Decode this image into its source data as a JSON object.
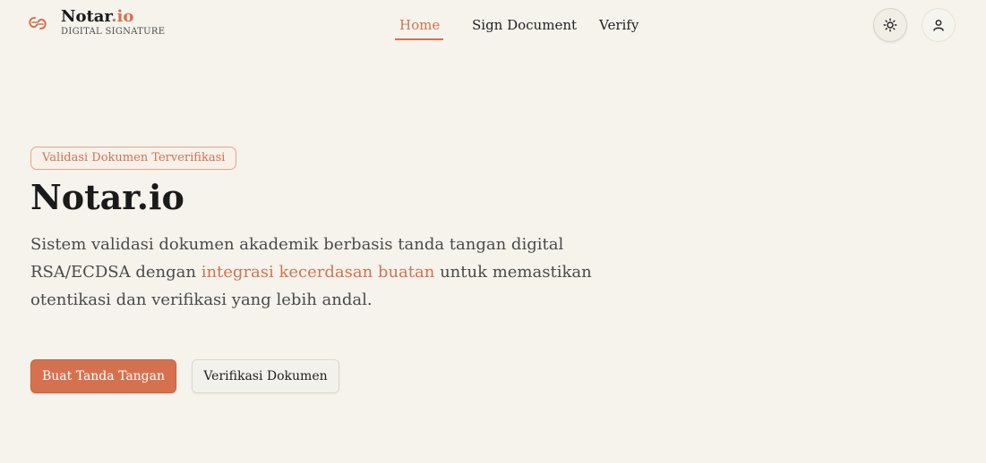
{
  "brand": {
    "name_main": "Notar",
    "name_accent": ".io",
    "subtitle": "DIGITAL SIGNATURE",
    "accent_color": "#d6714f"
  },
  "nav": {
    "items": [
      {
        "label": "Home",
        "active": true
      },
      {
        "label": "Sign Document",
        "active": false
      },
      {
        "label": "Verify",
        "active": false
      }
    ]
  },
  "header_actions": {
    "theme_icon": "sun-icon",
    "user_icon": "user-icon"
  },
  "hero": {
    "badge": "Validasi Dokumen Terverifikasi",
    "title": "Notar.io",
    "desc_part1": "Sistem validasi dokumen akademik berbasis tanda tangan digital RSA/ECDSA dengan ",
    "desc_highlight": "integrasi kecerdasan buatan",
    "desc_part2": " untuk memastikan otentikasi dan verifikasi yang lebih andal.",
    "primary_button": "Buat Tanda Tangan",
    "secondary_button": "Verifikasi Dokumen"
  },
  "colors": {
    "background": "#f5f3ec",
    "accent": "#d6714f",
    "text": "#1f1f1f"
  }
}
